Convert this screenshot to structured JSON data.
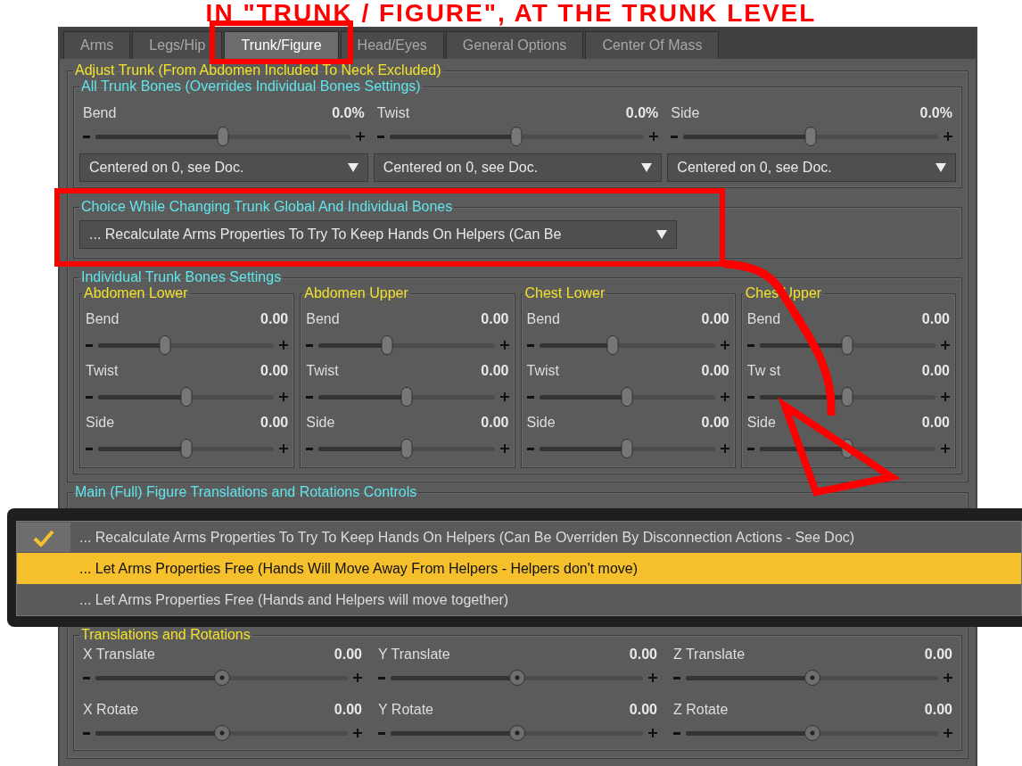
{
  "banner": "IN \"TRUNK / FIGURE\", AT THE TRUNK LEVEL",
  "tabs": [
    {
      "label": "Arms",
      "selected": false,
      "highlighted": false
    },
    {
      "label": "Legs/Hip",
      "selected": false,
      "highlighted": false
    },
    {
      "label": "Trunk/Figure",
      "selected": true,
      "highlighted": true
    },
    {
      "label": "Head/Eyes",
      "selected": false,
      "highlighted": false
    },
    {
      "label": "General Options",
      "selected": false,
      "highlighted": false
    },
    {
      "label": "Center Of Mass",
      "selected": false,
      "highlighted": false
    }
  ],
  "trunk": {
    "title": "Adjust Trunk (From Abdomen Included To Neck Excluded)",
    "all_bones": {
      "title": "All Trunk Bones (Overrides Individual Bones Settings)",
      "controls": [
        {
          "label": "Bend",
          "reading": "0.0%",
          "level": 0.5,
          "mode": "Centered on 0, see Doc."
        },
        {
          "label": "Twist",
          "reading": "0.0%",
          "level": 0.5,
          "mode": "Centered on 0, see Doc."
        },
        {
          "label": "Side",
          "reading": "0.0%",
          "level": 0.5,
          "mode": "Centered on 0, see Doc."
        }
      ]
    },
    "choice": {
      "title": "Choice While Changing Trunk Global And Individual Bones",
      "value": "... Recalculate Arms Properties To Try To Keep Hands On Helpers (Can Be",
      "highlighted": true
    },
    "individual": {
      "title": "Individual Trunk Bones Settings",
      "bones": [
        {
          "name": "Abdomen Lower",
          "sliders": [
            {
              "label": "Bend",
              "reading": "0.00",
              "level": 0.37
            },
            {
              "label": "Twist",
              "reading": "0.00",
              "level": 0.5
            },
            {
              "label": "Side",
              "reading": "0.00",
              "level": 0.5
            }
          ]
        },
        {
          "name": "Abdomen Upper",
          "sliders": [
            {
              "label": "Bend",
              "reading": "0.00",
              "level": 0.38
            },
            {
              "label": "Twist",
              "reading": "0.00",
              "level": 0.5
            },
            {
              "label": "Side",
              "reading": "0.00",
              "level": 0.5
            }
          ]
        },
        {
          "name": "Chest Lower",
          "sliders": [
            {
              "label": "Bend",
              "reading": "0.00",
              "level": 0.41
            },
            {
              "label": "Twist",
              "reading": "0.00",
              "level": 0.5
            },
            {
              "label": "Side",
              "reading": "0.00",
              "level": 0.5
            }
          ]
        },
        {
          "name": "Ches Upper",
          "sliders": [
            {
              "label": "Bend",
              "reading": "0.00",
              "level": 0.5
            },
            {
              "label": "Tw st",
              "reading": "0.00",
              "level": 0.5
            },
            {
              "label": "Side",
              "reading": "0.00",
              "level": 0.5
            }
          ]
        }
      ]
    }
  },
  "main": {
    "title": "Main (Full) Figure Translations and Rotations Controls",
    "group": {
      "title": "Translations and Rotations",
      "sliders": [
        {
          "label": "X Translate",
          "reading": "0.00",
          "level": 0.5
        },
        {
          "label": "Y Translate",
          "reading": "0.00",
          "level": 0.5
        },
        {
          "label": "Z Translate",
          "reading": "0.00",
          "level": 0.5
        },
        {
          "label": "X Rotate",
          "reading": "0.00",
          "level": 0.5
        },
        {
          "label": "Y Rotate",
          "reading": "0.00",
          "level": 0.5
        },
        {
          "label": "Z Rotate",
          "reading": "0.00",
          "level": 0.5
        }
      ]
    }
  },
  "popup": {
    "options": [
      {
        "label": "... Recalculate Arms Properties To Try To Keep Hands On Helpers (Can Be Overriden By Disconnection Actions - See Doc)",
        "checked": true,
        "selected": false
      },
      {
        "label": "... Let Arms Properties Free (Hands Will Move Away From Helpers - Helpers don't move)",
        "checked": false,
        "selected": true
      },
      {
        "label": "... Let Arms Properties Free (Hands and Helpers will move together)",
        "checked": false,
        "selected": false
      }
    ]
  }
}
